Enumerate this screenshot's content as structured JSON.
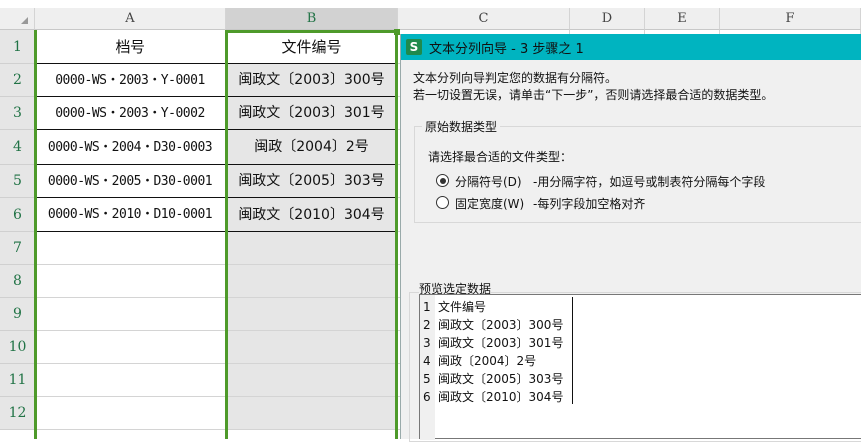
{
  "columns": [
    "A",
    "B",
    "C",
    "D",
    "E",
    "F"
  ],
  "rows": [
    "1",
    "2",
    "3",
    "4",
    "5",
    "6",
    "7",
    "8",
    "9",
    "10",
    "11",
    "12"
  ],
  "sheet": [
    [
      "档号",
      "文件编号"
    ],
    [
      "0000-WS・2003・Y-0001",
      "闽政文〔2003〕300号"
    ],
    [
      "0000-WS・2003・Y-0002",
      "闽政文〔2003〕301号"
    ],
    [
      "0000-WS・2004・D30-0003",
      "闽政〔2004〕2号"
    ],
    [
      "0000-WS・2005・D30-0001",
      "闽政文〔2005〕303号"
    ],
    [
      "0000-WS・2010・D10-0001",
      "闽政文〔2010〕304号"
    ]
  ],
  "dialog": {
    "icon": "S",
    "title": "文本分列向导 - 3 步骤之 1",
    "intro1": "文本分列向导判定您的数据有分隔符。",
    "intro2": "若一切设置无误，请单击“下一步”，否则请选择最合适的数据类型。",
    "group_label": "原始数据类型",
    "prompt": "请选择最合适的文件类型：",
    "options": [
      {
        "label": "分隔符号(D)",
        "desc": "-用分隔字符，如逗号或制表符分隔每个字段",
        "selected": true
      },
      {
        "label": "固定宽度(W)",
        "desc": "-每列字段加空格对齐",
        "selected": false
      }
    ],
    "preview_label": "预览选定数据",
    "preview": [
      {
        "n": "1",
        "text": "文件编号"
      },
      {
        "n": "2",
        "text": "闽政文〔2003〕300号"
      },
      {
        "n": "3",
        "text": "闽政文〔2003〕301号"
      },
      {
        "n": "4",
        "text": "闽政〔2004〕2号"
      },
      {
        "n": "5",
        "text": "闽政文〔2005〕303号"
      },
      {
        "n": "6",
        "text": "闽政文〔2010〕304号"
      }
    ]
  },
  "colors": {
    "accent": "#00b4c0",
    "selection": "#4e9a2a"
  }
}
